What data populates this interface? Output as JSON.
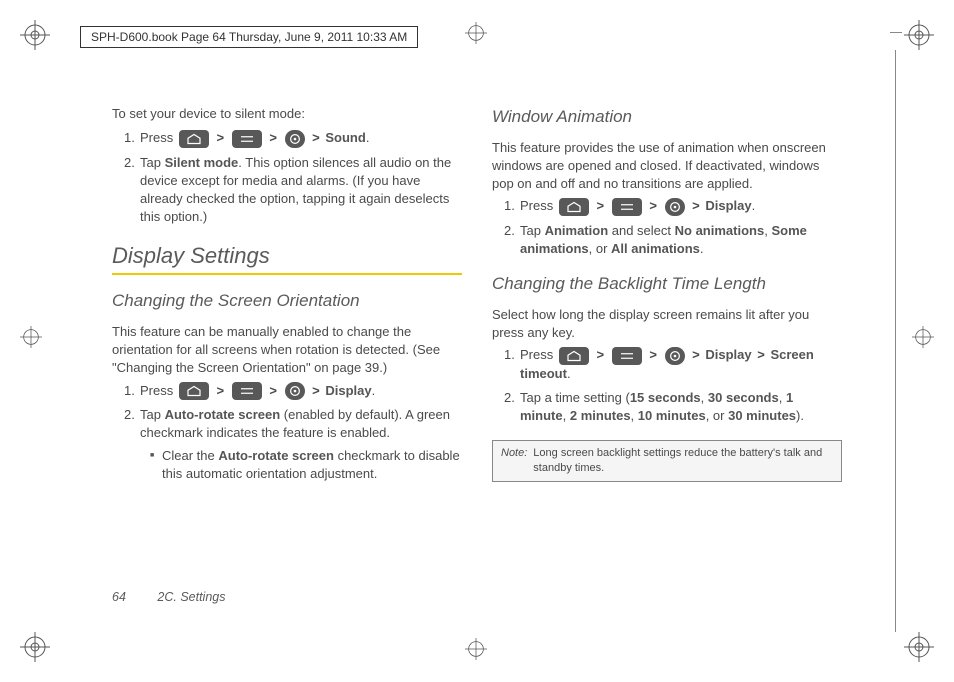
{
  "header": "SPH-D600.book  Page 64  Thursday, June 9, 2011  10:33 AM",
  "left": {
    "intro": "To set your device to silent mode:",
    "step1a": "Press ",
    "step1b": "Sound",
    "step2a": "Tap ",
    "step2b": "Silent mode",
    "step2c": ". This option silences all audio on the device except for media and alarms. (If you have already checked the option, tapping it again deselects this option.)",
    "h1": "Display Settings",
    "h2a": "Changing the Screen Orientation",
    "para_a": "This feature can be manually enabled to change the orientation for all screens when rotation is detected. (See \"Changing the Screen Orientation\" on page 39.)",
    "stepA1a": "Press ",
    "stepA1b": "Display",
    "stepA2a": "Tap ",
    "stepA2b": "Auto-rotate screen",
    "stepA2c": " (enabled by default). A green checkmark indicates the feature is enabled.",
    "sub_a": "Clear the ",
    "sub_b": "Auto-rotate screen",
    "sub_c": " checkmark to disable this automatic orientation adjustment."
  },
  "right": {
    "h2a": "Window Animation",
    "para_a": "This feature provides the use of animation when onscreen windows are opened and closed. If deactivated, windows pop on and off and no transitions are applied.",
    "stepA1a": "Press ",
    "stepA1b": "Display",
    "stepA2a": "Tap ",
    "stepA2b": "Animation",
    "stepA2c": " and select ",
    "stepA2d": "No animations",
    "stepA2e": "Some animations",
    "stepA2f": ", or ",
    "stepA2g": "All animations",
    "h2b": "Changing the Backlight Time Length",
    "para_b": "Select how long the display screen remains lit after you press any key.",
    "stepB1a": "Press ",
    "stepB1b": "Display",
    "stepB1c": "Screen timeout",
    "stepB2a": "Tap a time setting (",
    "stepB2b": "15 seconds",
    "stepB2c": "30 seconds",
    "stepB2d": "1 minute",
    "stepB2e": "2 minutes",
    "stepB2f": "10 minutes",
    "stepB2or": ", or ",
    "stepB2g": "30 minutes",
    "stepB2h": ").",
    "note_label": "Note:",
    "note_text": "Long screen backlight settings reduce the battery's talk and standby times."
  },
  "footer": {
    "page": "64",
    "section": "2C. Settings"
  },
  "sep": ", ",
  "period": ".",
  "gt": " > "
}
